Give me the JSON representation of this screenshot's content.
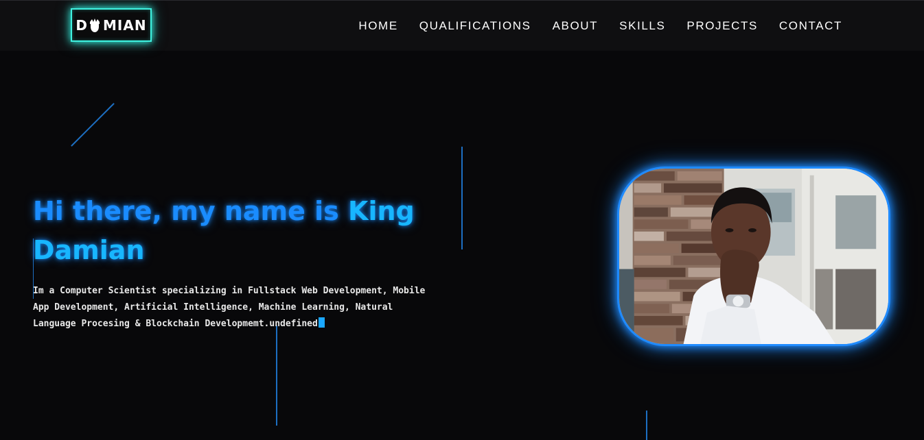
{
  "header": {
    "logo": "DMIAN",
    "nav": [
      {
        "label": "HOME"
      },
      {
        "label": "QUALIFICATIONS"
      },
      {
        "label": "ABOUT"
      },
      {
        "label": "SKILLS"
      },
      {
        "label": "PROJECTS"
      },
      {
        "label": "CONTACT"
      }
    ]
  },
  "hero": {
    "greeting": "Hi there, my name is ",
    "name": "King Damian",
    "description": "Im a Computer Scientist specializing in Fullstack Web Development, Mobile App Development, Artificial Intelligence, Machine Learning, Natural Language Procesing & Blockchain Developmemt.undefined"
  },
  "colors": {
    "background": "#08080a",
    "navbar": "#0f0f11",
    "logo_glow": "#3ff2e0",
    "title": "#1a8cff",
    "name_accent": "#18b6ff",
    "frame_glow": "#1f8bff",
    "decor_line": "#1d6fc2"
  }
}
